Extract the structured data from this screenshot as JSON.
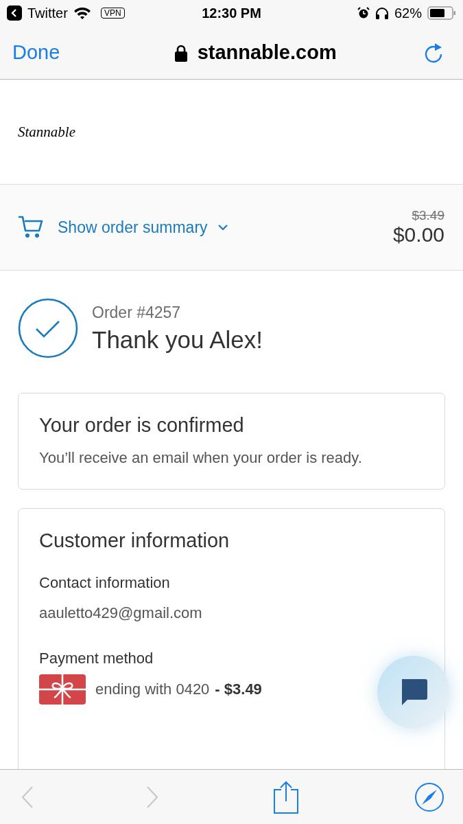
{
  "status_bar": {
    "back_app": "Twitter",
    "vpn": "VPN",
    "time": "12:30 PM",
    "battery": "62%"
  },
  "browser_bar": {
    "done": "Done",
    "url": "stannable.com"
  },
  "logo": "Stannable",
  "order_summary": {
    "toggle": "Show order summary",
    "original_price": "$3.49",
    "total": "$0.00"
  },
  "order": {
    "number": "Order #4257",
    "thank_you": "Thank you Alex!"
  },
  "confirmation": {
    "title": "Your order is confirmed",
    "message": "You’ll receive an email when your order is ready."
  },
  "customer_information": {
    "title": "Customer information",
    "sections": [
      {
        "kind": "text",
        "heading": "Contact information",
        "value": "aauletto429@gmail.com"
      },
      {
        "kind": "payment",
        "heading": "Payment method",
        "value": "ending with 0420",
        "amount": "- $3.49"
      }
    ]
  },
  "toolbar": {
    "back": {
      "disabled": true
    },
    "forward": {
      "disabled": true
    }
  }
}
